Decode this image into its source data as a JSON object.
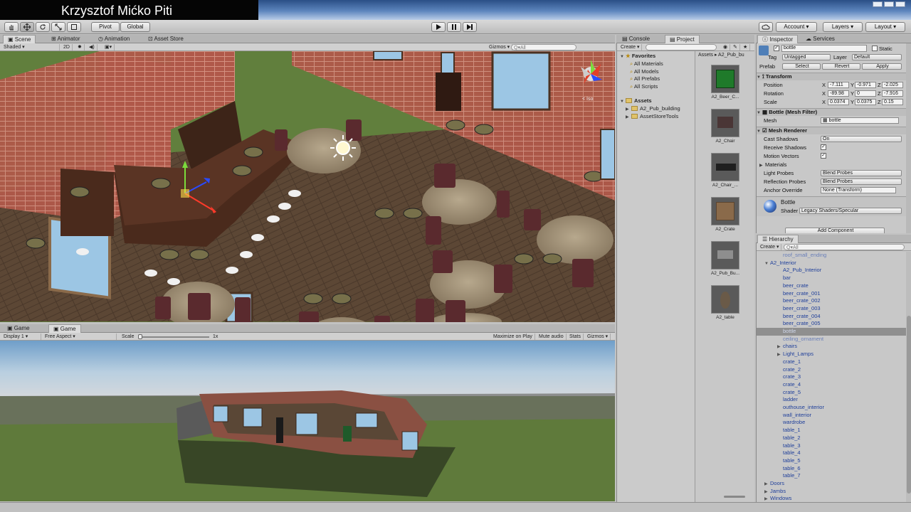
{
  "overlay_title": "Krzysztof Mićko Piti",
  "toolbar": {
    "pivot": "Pivot",
    "global": "Global",
    "account": "Account",
    "layers": "Layers",
    "layout": "Layout",
    "hand_tool_icon": "hand-icon",
    "move_tool_icon": "move-icon",
    "rotate_tool_icon": "rotate-icon",
    "scale_tool_icon": "scale-icon",
    "rect_tool_icon": "rect-icon"
  },
  "scene_tabs": {
    "scene": "Scene",
    "animator": "Animator",
    "animation": "Animation",
    "asset_store": "Asset Store"
  },
  "scene_bar": {
    "shading": "Shaded",
    "mode_2d": "2D",
    "gizmos": "Gizmos",
    "search_placeholder": "Q▾All"
  },
  "scene_gizmo_label": "< Iso",
  "game_tabs": {
    "game1": "Game",
    "game2": "Game"
  },
  "game_bar": {
    "display": "Display 1",
    "aspect": "Free Aspect",
    "scale_label": "Scale",
    "scale_value": "1x",
    "maximize": "Maximize on Play",
    "mute": "Mute audio",
    "stats": "Stats",
    "gizmos": "Gizmos"
  },
  "project_tabs": {
    "console": "Console",
    "project": "Project"
  },
  "project": {
    "create": "Create",
    "favorites_title": "Favorites",
    "favorites": [
      "All Materials",
      "All Models",
      "All Prefabs",
      "All Scripts"
    ],
    "assets_title": "Assets",
    "folders": [
      "A2_Pub_building",
      "AssetStoreTools"
    ],
    "breadcrumb": "Assets ▸ A2_Pub_bu",
    "assets": [
      {
        "label": "A2_Beer_C...",
        "color": "#1f7a2a"
      },
      {
        "label": "A2_Chair",
        "color": "#4a3636"
      },
      {
        "label": "A2_Chair_...",
        "color": "#3b3b3b"
      },
      {
        "label": "A2_Crate",
        "color": "#8a6a4a"
      },
      {
        "label": "A2_Pub_Bu...",
        "color": "#6e6e6e"
      },
      {
        "label": "A2_table",
        "color": "#6a5a48"
      }
    ]
  },
  "inspector_tabs": {
    "inspector": "Inspector",
    "services": "Services"
  },
  "inspector": {
    "object_name": "bottle",
    "static": "Static",
    "tag_label": "Tag",
    "tag_value": "Untagged",
    "layer_label": "Layer",
    "layer_value": "Default",
    "prefab_label": "Prefab",
    "prefab_select": "Select",
    "prefab_revert": "Revert",
    "prefab_apply": "Apply",
    "transform_title": "Transform",
    "position_label": "Position",
    "position": {
      "x": "-7.111",
      "y": "-0.971",
      "z": "-2.025"
    },
    "rotation_label": "Rotation",
    "rotation": {
      "x": "-89.98",
      "y": "0",
      "z": "-7.916"
    },
    "scale_label": "Scale",
    "scale": {
      "x": "0.0374",
      "y": "0.0375",
      "z": "0.15"
    },
    "mesh_filter_title": "Bottle (Mesh Filter)",
    "mesh_label": "Mesh",
    "mesh_value": "bottle",
    "mesh_renderer_title": "Mesh Renderer",
    "cast_shadows_label": "Cast Shadows",
    "cast_shadows_value": "On",
    "receive_shadows_label": "Receive Shadows",
    "motion_vectors_label": "Motion Vectors",
    "materials_label": "Materials",
    "light_probes_label": "Light Probes",
    "light_probes_value": "Blend Probes",
    "reflection_probes_label": "Reflection Probes",
    "reflection_probes_value": "Blend Probes",
    "anchor_override_label": "Anchor Override",
    "anchor_override_value": "None (Transform)",
    "material_name": "Bottle",
    "shader_label": "Shader",
    "shader_value": "Legacy Shaders/Specular",
    "add_component": "Add Component"
  },
  "hierarchy_tab": "Hierarchy",
  "hierarchy": {
    "create": "Create",
    "search_placeholder": "Q▾All",
    "items": [
      {
        "label": "roof_small_ending",
        "indent": 1,
        "arrow": "",
        "state": "dim"
      },
      {
        "label": "A2_Interior",
        "indent": 0,
        "arrow": "▼",
        "state": "normal"
      },
      {
        "label": "A2_Pub_Interior",
        "indent": 1,
        "arrow": "",
        "state": "normal"
      },
      {
        "label": "bar",
        "indent": 1,
        "arrow": "",
        "state": "normal"
      },
      {
        "label": "beer_crate",
        "indent": 1,
        "arrow": "",
        "state": "normal"
      },
      {
        "label": "beer_crate_001",
        "indent": 1,
        "arrow": "",
        "state": "normal"
      },
      {
        "label": "beer_crate_002",
        "indent": 1,
        "arrow": "",
        "state": "normal"
      },
      {
        "label": "beer_crate_003",
        "indent": 1,
        "arrow": "",
        "state": "normal"
      },
      {
        "label": "beer_crate_004",
        "indent": 1,
        "arrow": "",
        "state": "normal"
      },
      {
        "label": "beer_crate_005",
        "indent": 1,
        "arrow": "",
        "state": "normal"
      },
      {
        "label": "bottle",
        "indent": 1,
        "arrow": "",
        "state": "selected"
      },
      {
        "label": "ceiling_ornament",
        "indent": 1,
        "arrow": "",
        "state": "dim"
      },
      {
        "label": "chairs",
        "indent": 1,
        "arrow": "▶",
        "state": "normal"
      },
      {
        "label": "Light_Lamps",
        "indent": 1,
        "arrow": "▶",
        "state": "normal"
      },
      {
        "label": "crate_1",
        "indent": 1,
        "arrow": "",
        "state": "normal"
      },
      {
        "label": "crate_2",
        "indent": 1,
        "arrow": "",
        "state": "normal"
      },
      {
        "label": "crate_3",
        "indent": 1,
        "arrow": "",
        "state": "normal"
      },
      {
        "label": "crate_4",
        "indent": 1,
        "arrow": "",
        "state": "normal"
      },
      {
        "label": "crate_5",
        "indent": 1,
        "arrow": "",
        "state": "normal"
      },
      {
        "label": "ladder",
        "indent": 1,
        "arrow": "",
        "state": "normal"
      },
      {
        "label": "outhouse_interior",
        "indent": 1,
        "arrow": "",
        "state": "normal"
      },
      {
        "label": "wall_interior",
        "indent": 1,
        "arrow": "",
        "state": "normal"
      },
      {
        "label": "wardrobe",
        "indent": 1,
        "arrow": "",
        "state": "normal"
      },
      {
        "label": "table_1",
        "indent": 1,
        "arrow": "",
        "state": "normal"
      },
      {
        "label": "table_2",
        "indent": 1,
        "arrow": "",
        "state": "normal"
      },
      {
        "label": "table_3",
        "indent": 1,
        "arrow": "",
        "state": "normal"
      },
      {
        "label": "table_4",
        "indent": 1,
        "arrow": "",
        "state": "normal"
      },
      {
        "label": "table_5",
        "indent": 1,
        "arrow": "",
        "state": "normal"
      },
      {
        "label": "table_6",
        "indent": 1,
        "arrow": "",
        "state": "normal"
      },
      {
        "label": "table_7",
        "indent": 1,
        "arrow": "",
        "state": "normal"
      },
      {
        "label": "Doors",
        "indent": 0,
        "arrow": "▶",
        "state": "normal"
      },
      {
        "label": "Jambs",
        "indent": 0,
        "arrow": "▶",
        "state": "normal"
      },
      {
        "label": "Windows",
        "indent": 0,
        "arrow": "▶",
        "state": "normal"
      }
    ]
  },
  "colors": {
    "hierarchy_text": "#1f3f9a",
    "selected_row": "#8f8f8f",
    "panel_bg": "#c8c8c8"
  }
}
